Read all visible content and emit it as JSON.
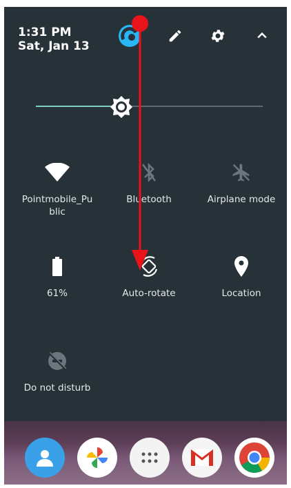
{
  "header": {
    "time": "1:31 PM",
    "date": "Sat, Jan 13",
    "icons": [
      "account-icon",
      "edit-icon",
      "gear-icon",
      "chevron-up-icon"
    ]
  },
  "brightness": {
    "level": 0.38,
    "icon": "brightness-icon"
  },
  "tiles": [
    {
      "label": "Pointmobile_Pu\nblic",
      "icon": "wifi-icon",
      "state": "on"
    },
    {
      "label": "Bluetooth",
      "icon": "bluetooth-off-icon",
      "state": "off"
    },
    {
      "label": "Airplane mode",
      "icon": "airplane-off-icon",
      "state": "off"
    },
    {
      "label": "61%",
      "icon": "battery-icon",
      "state": "on"
    },
    {
      "label": "Auto-rotate",
      "icon": "auto-rotate-icon",
      "state": "on"
    },
    {
      "label": "Location",
      "icon": "location-icon",
      "state": "on"
    },
    {
      "label": "Do not disturb",
      "icon": "dnd-off-icon",
      "state": "off"
    }
  ],
  "dock": [
    "contacts-icon",
    "photos-icon",
    "app-drawer-icon",
    "gmail-icon",
    "chrome-icon"
  ],
  "colors": {
    "panel": "#263238",
    "accent": "#80cbc4",
    "annotation": "#e8141a"
  }
}
